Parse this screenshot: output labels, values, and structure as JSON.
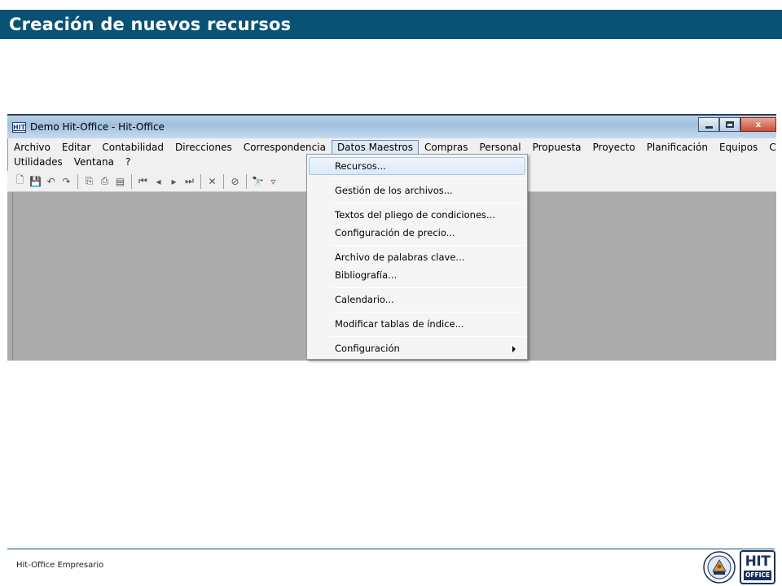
{
  "slide": {
    "title": "Creación de nuevos recursos",
    "footer": "Hit-Office Empresario",
    "logo": {
      "line1": "HIT",
      "line2": "OFFICE"
    }
  },
  "window": {
    "icon_label": "HIT",
    "title": "Demo Hit-Office - Hit-Office",
    "buttons": {
      "minimize": "minimize-icon",
      "maximize": "maximize-icon",
      "close_glyph": "x"
    }
  },
  "menubar": {
    "row1": [
      "Archivo",
      "Editar",
      "Contabilidad",
      "Direcciones",
      "Correspondencia",
      "Datos Maestros",
      "Compras",
      "Personal",
      "Propuesta",
      "Proyecto",
      "Planificación",
      "Equipos",
      "Configuración"
    ],
    "row2": [
      "Utilidades",
      "Ventana",
      "?"
    ],
    "active": "Datos Maestros"
  },
  "toolbar": {
    "icons": [
      "new-icon",
      "save-icon",
      "undo-icon",
      "redo-icon",
      "copy-icon",
      "print-icon",
      "preview-icon",
      "first-icon",
      "prev-icon",
      "next-icon",
      "last-icon",
      "delete-icon",
      "link-icon",
      "find-icon",
      "filter-icon"
    ],
    "glyphs": {
      "new": "🗋",
      "save": "💾",
      "undo": "↶",
      "redo": "↷",
      "copy": "⎘",
      "print": "⎙",
      "preview": "▤",
      "first": "⏮",
      "prev": "◂",
      "next": "▸",
      "last": "⏭",
      "delete": "✕",
      "link": "⊘",
      "find": "🔭",
      "filter": "▿"
    }
  },
  "dropdown": {
    "items": [
      {
        "label": "Recursos...",
        "highlighted": true
      },
      {
        "label": "Gestión de los archivos..."
      },
      {
        "label": "Textos del pliego de condiciones..."
      },
      {
        "label": "Configuración de precio..."
      },
      {
        "label": "Archivo de palabras clave..."
      },
      {
        "label": "Bibliografía..."
      },
      {
        "label": "Calendario..."
      },
      {
        "label": "Modificar tablas de índice..."
      },
      {
        "label": "Configuración",
        "submenu": true
      }
    ]
  },
  "colors": {
    "title_bar": "#0a5275",
    "workspace": "#ababab",
    "menu_bg": "#f0f0f0",
    "highlight": "#dbe9f8"
  }
}
